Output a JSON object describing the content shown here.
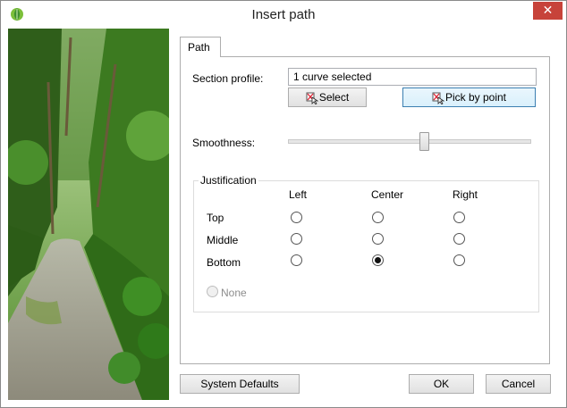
{
  "window": {
    "title": "Insert path",
    "app_icon": "leaf-app-icon",
    "close_icon": "close-icon",
    "close_glyph": "✕"
  },
  "tabs": [
    {
      "label": "Path",
      "active": true
    }
  ],
  "section_profile": {
    "label": "Section profile:",
    "value": "1 curve selected",
    "select_button": "Select",
    "pick_button": "Pick by point"
  },
  "smoothness": {
    "label": "Smoothness:",
    "value_fraction": 0.56
  },
  "justification": {
    "legend": "Justification",
    "columns": [
      "Left",
      "Center",
      "Right"
    ],
    "rows": [
      "Top",
      "Middle",
      "Bottom"
    ],
    "selected": {
      "row": "Bottom",
      "column": "Center"
    },
    "none_label": "None",
    "none_enabled": false
  },
  "footer": {
    "system_defaults": "System Defaults",
    "ok": "OK",
    "cancel": "Cancel"
  },
  "colors": {
    "close_button": "#c7433a",
    "hover_border": "#3c7fb1"
  }
}
